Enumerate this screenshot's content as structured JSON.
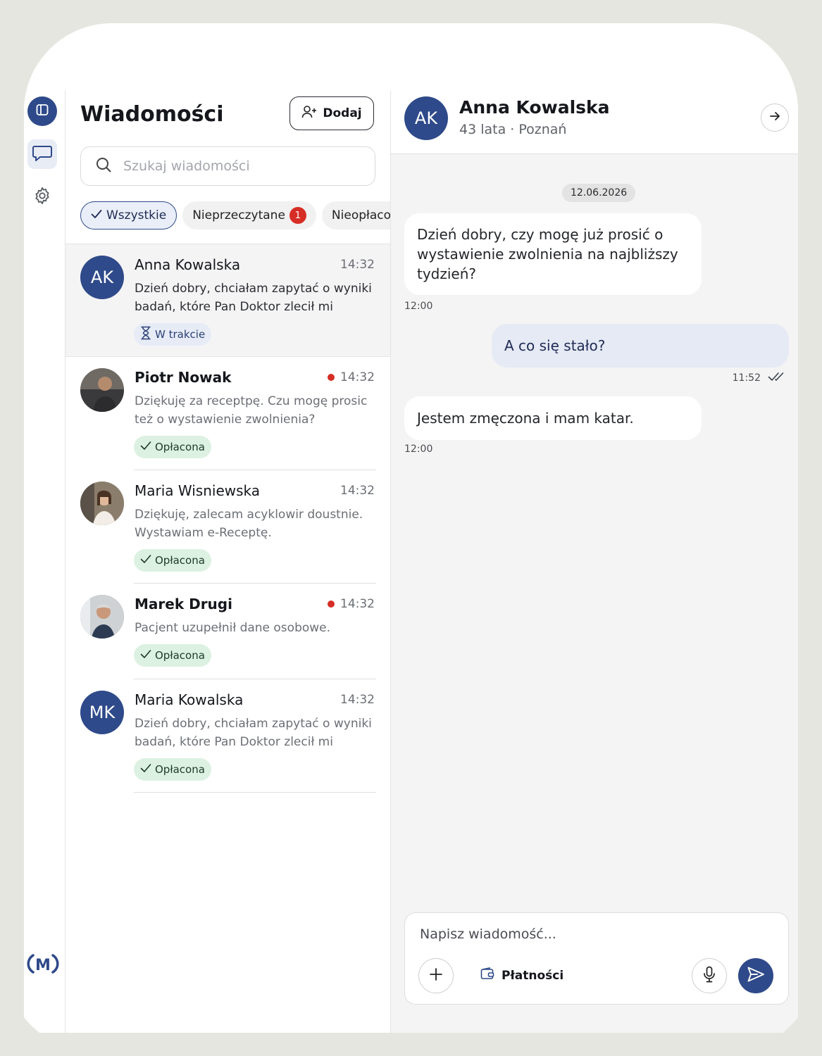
{
  "sidebar": {
    "icons": [
      "sidebar-toggle-icon",
      "chat-icon",
      "gear-icon"
    ],
    "logo_text": "M"
  },
  "list": {
    "title": "Wiadomości",
    "add_label": "Dodaj",
    "search_placeholder": "Szukaj wiadomości",
    "filters": [
      {
        "label": "Wszystkie",
        "active": true
      },
      {
        "label": "Nieprzeczytane",
        "count": "1"
      },
      {
        "label": "Nieopłacone"
      }
    ],
    "conversations": [
      {
        "initials": "AK",
        "name": "Anna Kowalska",
        "time": "14:32",
        "unread": false,
        "preview": "Dzień dobry, chciałam zapytać o wyniki badań, które Pan Doktor zlecił mi tydzie...",
        "status": "W trakcie",
        "status_type": "in-progress",
        "selected": true
      },
      {
        "initials": "",
        "name": "Piotr Nowak",
        "time": "14:32",
        "unread": true,
        "preview": "Dziękuję za receptpę. Czu mogę prosic też o wystawienie zwolnienia?",
        "status": "Opłacona",
        "status_type": "paid"
      },
      {
        "initials": "",
        "name": "Maria Wisniewska",
        "time": "14:32",
        "unread": false,
        "preview": "Dziękuję, zalecam acyklowir doustnie. Wystawiam e-Receptę.",
        "status": "Opłacona",
        "status_type": "paid"
      },
      {
        "initials": "",
        "name": "Marek Drugi",
        "time": "14:32",
        "unread": true,
        "preview": "Pacjent uzupełnił dane osobowe.",
        "status": "Opłacona",
        "status_type": "paid"
      },
      {
        "initials": "MK",
        "name": "Maria Kowalska",
        "time": "14:32",
        "unread": false,
        "preview": "Dzień dobry, chciałam zapytać o wyniki badań, które Pan Doktor zlecił mi tydzie...",
        "status": "Opłacona",
        "status_type": "paid"
      }
    ]
  },
  "chat": {
    "initials": "AK",
    "name": "Anna Kowalska",
    "subtitle": "43 lata · Poznań",
    "date": "12.06.2026",
    "messages": [
      {
        "direction": "in",
        "text": "Dzień dobry, czy mogę już prosić o wystawienie zwolnienia na najbliższy tydzień?",
        "time": "12:00"
      },
      {
        "direction": "out",
        "text": "A co się stało?",
        "time": "11:52"
      },
      {
        "direction": "in",
        "text": "Jestem zmęczona i mam katar.",
        "time": "12:00"
      }
    ],
    "composer_placeholder": "Napisz wiadomość...",
    "payments_label": "Płatności"
  },
  "colors": {
    "accent": "#2f4a8a",
    "unread_dot": "#d62d25",
    "paid_bg": "#dcf1e2",
    "progress_bg": "#e6ebf6"
  }
}
